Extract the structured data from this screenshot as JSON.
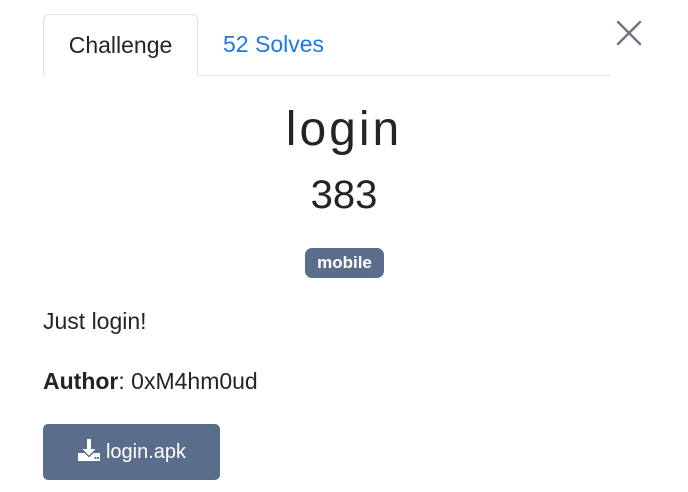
{
  "tabs": {
    "challenge_label": "Challenge",
    "solves_label": "52 Solves"
  },
  "challenge": {
    "name": "login",
    "value": "383",
    "tag": "mobile",
    "description": "Just login!",
    "author_label": "Author",
    "author_separator": ": ",
    "author_name": "0xM4hm0ud"
  },
  "files": [
    {
      "label": "login.apk",
      "icon": "download-icon"
    }
  ],
  "colors": {
    "accent_link": "#1e7ae0",
    "tag_bg": "#5a6e8c",
    "button_bg": "#5a6e8c"
  },
  "close_icon": "close-icon"
}
